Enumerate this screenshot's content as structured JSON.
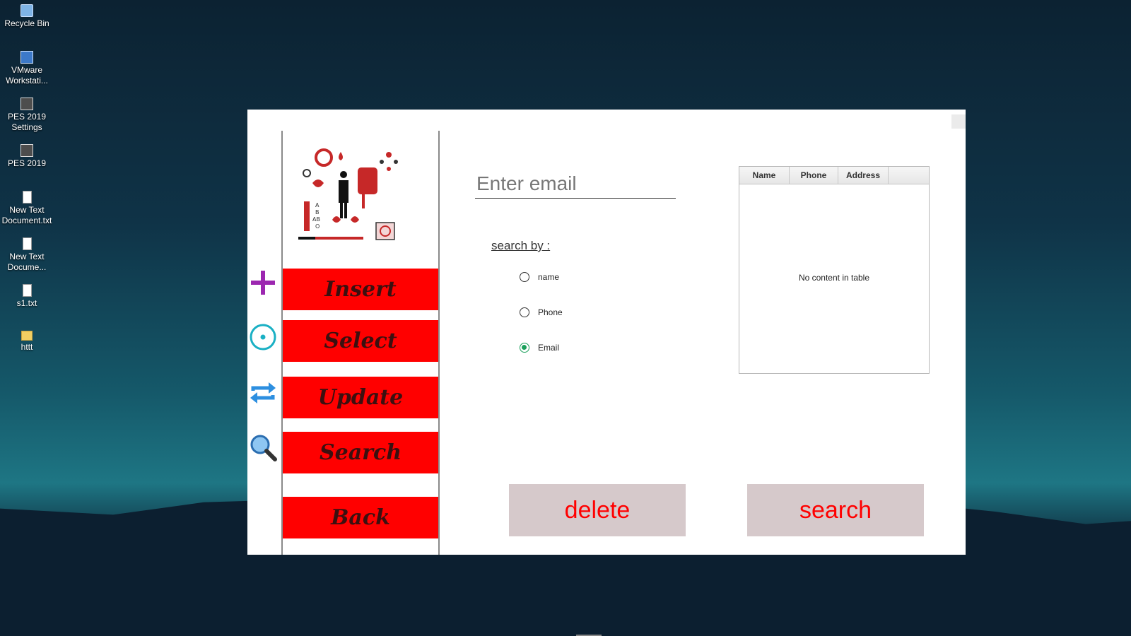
{
  "desktop": {
    "icons": [
      {
        "label": "Recycle Bin",
        "icon": "recycle-bin-icon"
      },
      {
        "label": "VMware Workstati...",
        "icon": "vmware-icon"
      },
      {
        "label": "PES 2019 Settings",
        "icon": "pes-settings-icon"
      },
      {
        "label": "PES 2019",
        "icon": "pes-icon"
      },
      {
        "label": "New Text Document.txt",
        "icon": "text-file-icon"
      },
      {
        "label": "New Text Docume...",
        "icon": "text-file-icon"
      },
      {
        "label": "s1.txt",
        "icon": "text-file-icon"
      },
      {
        "label": "httt",
        "icon": "folder-icon"
      }
    ]
  },
  "nav": {
    "insert": "Insert",
    "select": "Select",
    "update": "Update",
    "search": "Search",
    "back": "Back"
  },
  "form": {
    "email_placeholder": "Enter email",
    "email_value": "",
    "search_by_label": "search by :",
    "options": [
      {
        "label": "name",
        "checked": false
      },
      {
        "label": "Phone",
        "checked": false
      },
      {
        "label": "Email",
        "checked": true
      }
    ]
  },
  "table": {
    "columns": [
      "Name",
      "Phone",
      "Address"
    ],
    "rows": [],
    "empty_text": "No content in table"
  },
  "actions": {
    "delete_label": "delete",
    "search_label": "search"
  },
  "colors": {
    "nav_button": "#ff0000",
    "action_button_bg": "#d6c9cb",
    "action_text": "#ff0000",
    "radio_checked": "#19a05a"
  }
}
